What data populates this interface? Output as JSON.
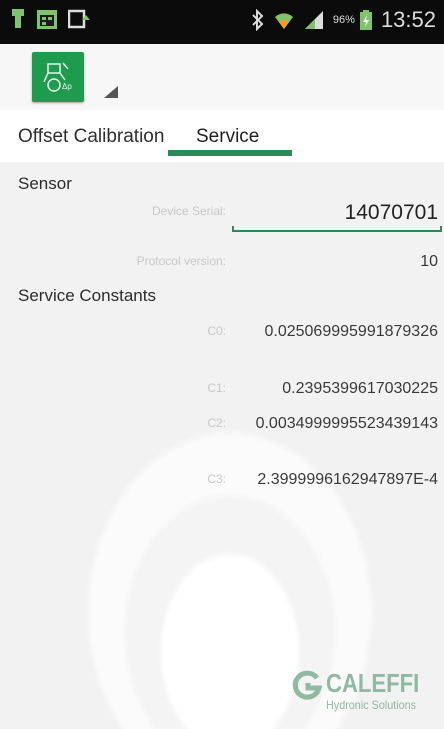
{
  "status_bar": {
    "battery_percent": "96%",
    "time": "13:52",
    "icons": [
      "torch-icon",
      "calendar-icon",
      "screen-share-icon",
      "bluetooth-icon",
      "wifi-icon",
      "signal-icon",
      "battery-icon"
    ]
  },
  "tabs": [
    {
      "label": "Offset Calibration",
      "selected": false
    },
    {
      "label": "Service",
      "selected": true
    }
  ],
  "sensor": {
    "title": "Sensor",
    "device_serial_label": "Device Serial:",
    "device_serial_value": "14070701",
    "protocol_label": "Protocol version:",
    "protocol_value": "10"
  },
  "service_constants": {
    "title": "Service Constants",
    "items": [
      {
        "label": "C0:",
        "value": "0.025069995991879326"
      },
      {
        "label": "C1:",
        "value": "0.2395399617030225"
      },
      {
        "label": "C2:",
        "value": "0.0034999995523439143"
      },
      {
        "label": "C3:",
        "value": "2.3999996162947897E-4"
      }
    ]
  },
  "logo": {
    "word": "CALEFFI",
    "sub": "Hydronic Solutions"
  },
  "colors": {
    "accent": "#2a8a5a",
    "app_icon": "#1e9b4e",
    "logo": "#8fb9a0"
  }
}
